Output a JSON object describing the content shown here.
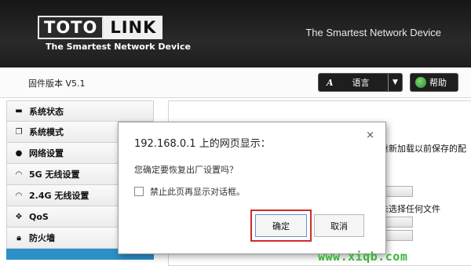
{
  "header": {
    "logo_part1": "TOTO",
    "logo_part2": "LINK",
    "logo_tagline": "The Smartest Network Device",
    "right_title": "The Smartest Network Device"
  },
  "topbar": {
    "firmware": "固件版本 V5.1",
    "language_icon": "A",
    "language_label": "语言",
    "help_label": "帮助"
  },
  "sidebar": {
    "items": [
      {
        "icon": "status-icon",
        "label": "系统状态"
      },
      {
        "icon": "mode-icon",
        "label": "系统模式"
      },
      {
        "icon": "globe-icon",
        "label": "网络设置"
      },
      {
        "icon": "wifi-icon",
        "label": "5G 无线设置"
      },
      {
        "icon": "wifi-icon",
        "label": "2.4G 无线设置"
      },
      {
        "icon": "qos-icon",
        "label": "QoS"
      },
      {
        "icon": "lock-icon",
        "label": "防火墙"
      }
    ]
  },
  "content": {
    "text1": "重新加载以前保存的配",
    "text2": "未选择任何文件"
  },
  "dialog": {
    "title": "192.168.0.1 上的网页显示：",
    "close": "×",
    "message": "您确定要恢复出厂设置吗？",
    "checkbox_label": "禁止此页再显示对话框。",
    "ok": "确定",
    "cancel": "取消"
  },
  "watermark": "www.xiqb.com",
  "colors": {
    "header_bg": "#1d1d1d",
    "active_sidebar": "#2b8fc8",
    "highlight_border": "#cf2b2b",
    "watermark": "#3ab53a"
  }
}
